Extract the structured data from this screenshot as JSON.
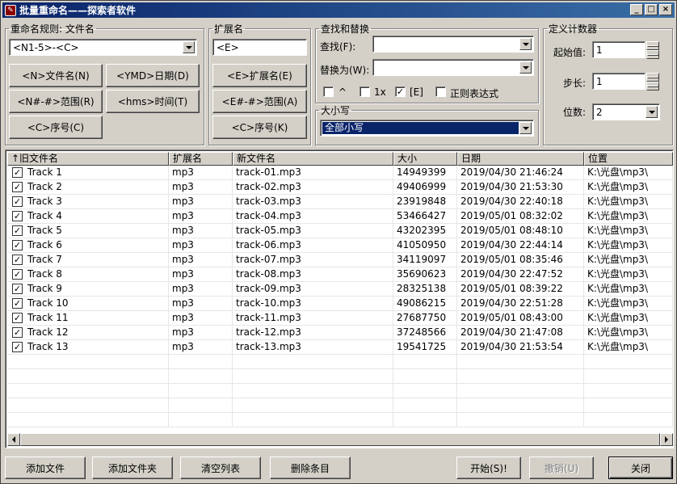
{
  "window": {
    "title": "批量重命名——探索者软件"
  },
  "rule": {
    "legend": "重命名规则: 文件名",
    "value": "<N1-5>-<C>",
    "buttons": [
      "<N>文件名(N)",
      "<YMD>日期(D)",
      "<N#-#>范围(R)",
      "<hms>时间(T)",
      "<C>序号(C)"
    ]
  },
  "ext": {
    "legend": "扩展名",
    "value": "<E>",
    "buttons": [
      "<E>扩展名(E)",
      "<E#-#>范围(A)",
      "<C>序号(K)"
    ]
  },
  "find": {
    "legend": "查找和替换",
    "find_label": "查找(F):",
    "find_value": "",
    "replace_label": "替换为(W):",
    "replace_value": "",
    "opt_caret": "^",
    "opt_1x": "1x",
    "opt_e": "[E]",
    "opt_regex": "正则表达式",
    "opt_e_checked": "✓"
  },
  "case": {
    "legend": "大小写",
    "value": "全部小写"
  },
  "counter": {
    "legend": "定义计数器",
    "start_label": "起始值:",
    "start_value": "1",
    "step_label": "步长:",
    "step_value": "1",
    "digits_label": "位数:",
    "digits_value": "2"
  },
  "table": {
    "columns": [
      "↑旧文件名",
      "扩展名",
      "新文件名",
      "大小",
      "日期",
      "位置"
    ],
    "check": "✓",
    "rows": [
      {
        "name": "Track 1",
        "ext": "mp3",
        "new": "track-01.mp3",
        "size": "14949399",
        "date": "2019/04/30 21:46:24",
        "path": "K:\\光盘\\mp3\\"
      },
      {
        "name": "Track 2",
        "ext": "mp3",
        "new": "track-02.mp3",
        "size": "49406999",
        "date": "2019/04/30 21:53:30",
        "path": "K:\\光盘\\mp3\\"
      },
      {
        "name": "Track 3",
        "ext": "mp3",
        "new": "track-03.mp3",
        "size": "23919848",
        "date": "2019/04/30 22:40:18",
        "path": "K:\\光盘\\mp3\\"
      },
      {
        "name": "Track 4",
        "ext": "mp3",
        "new": "track-04.mp3",
        "size": "53466427",
        "date": "2019/05/01 08:32:02",
        "path": "K:\\光盘\\mp3\\"
      },
      {
        "name": "Track 5",
        "ext": "mp3",
        "new": "track-05.mp3",
        "size": "43202395",
        "date": "2019/05/01 08:48:10",
        "path": "K:\\光盘\\mp3\\"
      },
      {
        "name": "Track 6",
        "ext": "mp3",
        "new": "track-06.mp3",
        "size": "41050950",
        "date": "2019/04/30 22:44:14",
        "path": "K:\\光盘\\mp3\\"
      },
      {
        "name": "Track 7",
        "ext": "mp3",
        "new": "track-07.mp3",
        "size": "34119097",
        "date": "2019/05/01 08:35:46",
        "path": "K:\\光盘\\mp3\\"
      },
      {
        "name": "Track 8",
        "ext": "mp3",
        "new": "track-08.mp3",
        "size": "35690623",
        "date": "2019/04/30 22:47:52",
        "path": "K:\\光盘\\mp3\\"
      },
      {
        "name": "Track 9",
        "ext": "mp3",
        "new": "track-09.mp3",
        "size": "28325138",
        "date": "2019/05/01 08:39:22",
        "path": "K:\\光盘\\mp3\\"
      },
      {
        "name": "Track 10",
        "ext": "mp3",
        "new": "track-10.mp3",
        "size": "49086215",
        "date": "2019/04/30 22:51:28",
        "path": "K:\\光盘\\mp3\\"
      },
      {
        "name": "Track 11",
        "ext": "mp3",
        "new": "track-11.mp3",
        "size": "27687750",
        "date": "2019/05/01 08:43:00",
        "path": "K:\\光盘\\mp3\\"
      },
      {
        "name": "Track 12",
        "ext": "mp3",
        "new": "track-12.mp3",
        "size": "37248566",
        "date": "2019/04/30 21:47:08",
        "path": "K:\\光盘\\mp3\\"
      },
      {
        "name": "Track 13",
        "ext": "mp3",
        "new": "track-13.mp3",
        "size": "19541725",
        "date": "2019/04/30 21:53:54",
        "path": "K:\\光盘\\mp3\\"
      }
    ]
  },
  "footer": {
    "add_file": "添加文件",
    "add_folder": "添加文件夹",
    "clear": "清空列表",
    "delete": "删除条目",
    "start": "开始(S)!",
    "undo": "撤销(U)",
    "close": "关闭"
  },
  "colors": {
    "titlebar": "#0a246a",
    "selection": "#0a246a",
    "face": "#d4d0c8"
  }
}
